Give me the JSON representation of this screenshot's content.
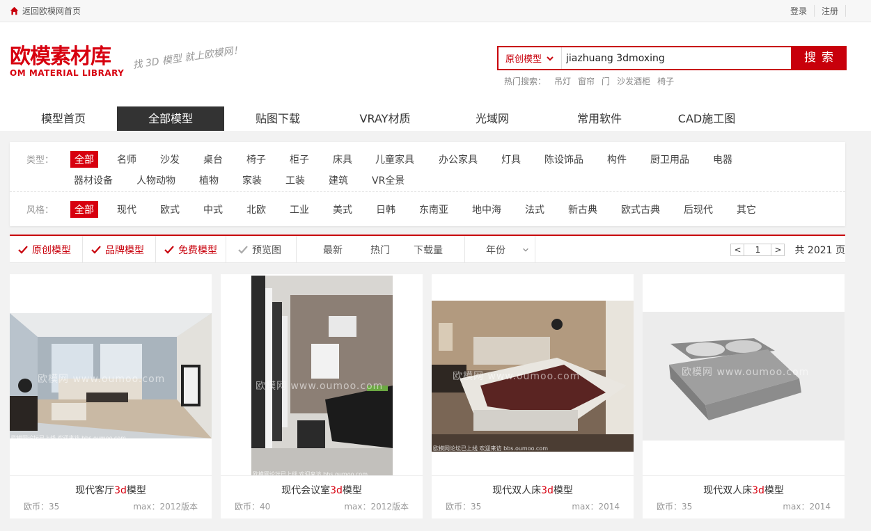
{
  "topbar": {
    "home_label": "返回欧模网首页",
    "login": "登录",
    "register": "注册"
  },
  "brand": {
    "logo_cn": "欧模素材库",
    "logo_en": "OM MATERIAL LIBRARY",
    "slogan": "找 3D 模型 就上欧模网！"
  },
  "search": {
    "category": "原创模型",
    "value": "jiazhuang 3dmoxing",
    "button": "搜索",
    "hot_label": "热门搜索：",
    "hot_keywords": [
      "吊灯",
      "窗帘",
      "门",
      "沙发酒柜",
      "椅子"
    ]
  },
  "nav": [
    "模型首页",
    "全部模型",
    "贴图下载",
    "VRAY材质",
    "光域网",
    "常用软件",
    "CAD施工图"
  ],
  "nav_active": "全部模型",
  "filters": {
    "type_label": "类型：",
    "types_row1": [
      "全部",
      "名师",
      "沙发",
      "桌台",
      "椅子",
      "柜子",
      "床具",
      "儿童家具",
      "办公家具",
      "灯具",
      "陈设饰品",
      "构件",
      "厨卫用品",
      "电器"
    ],
    "types_row2": [
      "器材设备",
      "人物动物",
      "植物",
      "家装",
      "工装",
      "建筑",
      "VR全景"
    ],
    "style_label": "风格：",
    "styles": [
      "全部",
      "现代",
      "欧式",
      "中式",
      "北欧",
      "工业",
      "美式",
      "日韩",
      "东南亚",
      "地中海",
      "法式",
      "新古典",
      "欧式古典",
      "后现代",
      "其它"
    ]
  },
  "sortbar": {
    "checks": [
      "原创模型",
      "品牌模型",
      "免费模型",
      "预览图"
    ],
    "sorts": [
      "最新",
      "热门",
      "下载量"
    ],
    "year": "年份",
    "page_prev": "<",
    "page_current": "1",
    "page_next": ">",
    "total": "共 2021 页"
  },
  "cards": [
    {
      "title_pre": "现代客厅",
      "title_hl": "3d",
      "title_post": "模型",
      "coin": "欧币：35",
      "max": "max：2012版本",
      "wm": "欧模网 www.oumoo.com",
      "wm2": "欧模网论坛已上线 欢迎来访 bbs.oumoo.com"
    },
    {
      "title_pre": "现代会议室",
      "title_hl": "3d",
      "title_post": "模型",
      "coin": "欧币：40",
      "max": "max：2012版本",
      "wm": "欧模网 www.oumoo.com",
      "wm2": "欧模网论坛已上线 欢迎来访 bbs.oumoo.com"
    },
    {
      "title_pre": "现代双人床",
      "title_hl": "3d",
      "title_post": "模型",
      "coin": "欧币：35",
      "max": "max：2014",
      "wm": "欧模网 www.oumoo.com",
      "wm2": "欧模网论坛已上线 欢迎来访 bbs.oumoo.com"
    },
    {
      "title_pre": "现代双人床",
      "title_hl": "3d",
      "title_post": "模型",
      "coin": "欧币：35",
      "max": "max：2014",
      "wm": "欧模网 www.oumoo.com",
      "wm2": ""
    }
  ],
  "colors": {
    "brand_red": "#d7000f",
    "search_red": "#c8000b",
    "nav_active_bg": "#333333"
  },
  "icons": {
    "home": "home-icon",
    "dropdown": "chevron-down-icon",
    "check": "check-icon"
  }
}
